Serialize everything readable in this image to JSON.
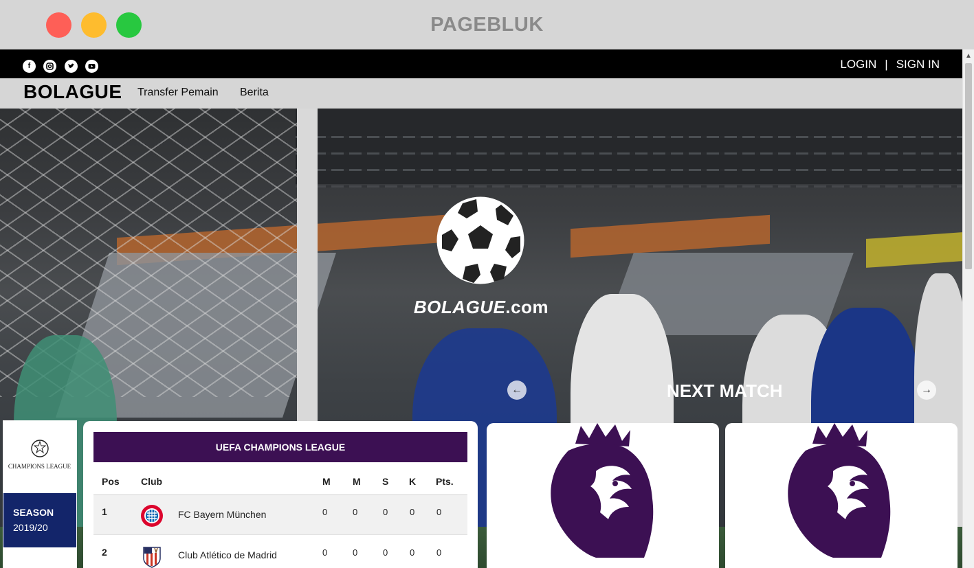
{
  "window": {
    "title": "PAGEBLUK"
  },
  "topbar": {
    "social_icons": [
      "facebook-icon",
      "instagram-icon",
      "twitter-icon",
      "youtube-icon"
    ],
    "login_label": "LOGIN",
    "separator": "|",
    "signin_label": "SIGN IN"
  },
  "navbar": {
    "brand": "BOLAGUE",
    "links": [
      "Transfer Pemain",
      "Berita"
    ]
  },
  "hero": {
    "logo_word": "BOLAGUE",
    "logo_suffix": ".com",
    "next_match_label": "NEXT MATCH"
  },
  "sidebar": {
    "league_logo_text": "CHAMPIONS LEAGUE",
    "season_label": "SEASON",
    "season_value": "2019/20"
  },
  "standings": {
    "title": "UEFA CHAMPIONS LEAGUE",
    "columns": [
      "Pos",
      "Club",
      "M",
      "M",
      "S",
      "K",
      "Pts."
    ],
    "rows": [
      {
        "pos": "1",
        "club": "FC Bayern München",
        "m1": "0",
        "m2": "0",
        "s": "0",
        "k": "0",
        "pts": "0"
      },
      {
        "pos": "2",
        "club": "Club Atlético de Madrid",
        "m1": "0",
        "m2": "0",
        "s": "0",
        "k": "0",
        "pts": "0"
      }
    ]
  },
  "colors": {
    "league_purple": "#3c1053",
    "season_blue": "#13256a",
    "topbar": "#000000",
    "navbar": "#d6d6d6"
  }
}
